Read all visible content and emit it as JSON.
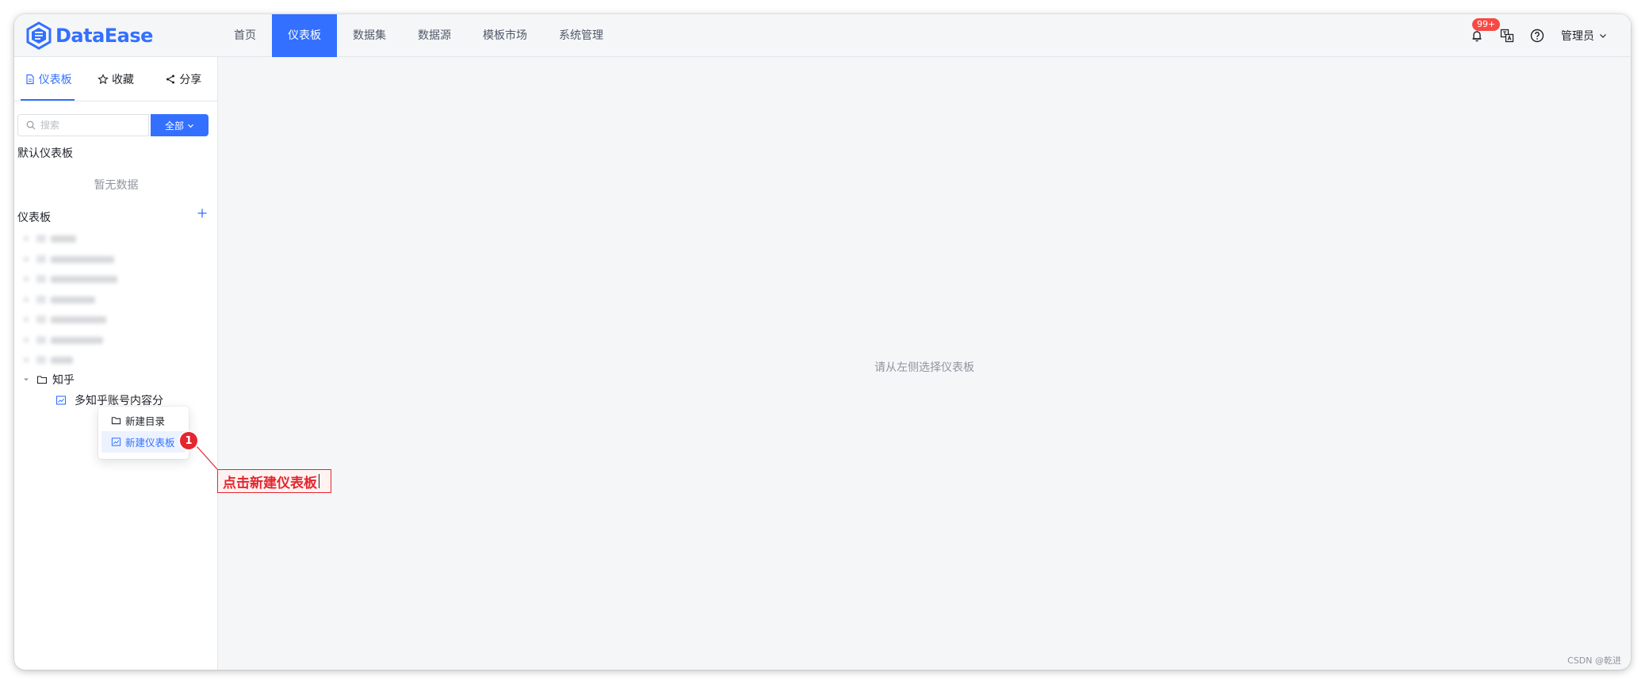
{
  "app": {
    "logo_text": "DataEase",
    "brand_color": "#3370ff"
  },
  "nav": {
    "items": [
      {
        "label": "首页"
      },
      {
        "label": "仪表板"
      },
      {
        "label": "数据集"
      },
      {
        "label": "数据源"
      },
      {
        "label": "模板市场"
      },
      {
        "label": "系统管理"
      }
    ],
    "active_index": 1
  },
  "header": {
    "badge": "99+",
    "user": "管理员"
  },
  "sidebar": {
    "tabs": [
      {
        "label": "仪表板",
        "icon": "document-icon"
      },
      {
        "label": "收藏",
        "icon": "star-icon"
      },
      {
        "label": "分享",
        "icon": "share-icon"
      }
    ],
    "search_placeholder": "搜索",
    "filter_label": "全部",
    "default_section_title": "默认仪表板",
    "empty_text": "暂无数据",
    "section_title": "仪表板",
    "folder_name": "知乎",
    "dashboard_name": "多知乎账号内容分"
  },
  "context_menu": {
    "items": [
      {
        "label": "新建目录",
        "icon": "folder-icon"
      },
      {
        "label": "新建仪表板",
        "icon": "dashboard-icon"
      }
    ]
  },
  "main": {
    "empty_text": "请从左侧选择仪表板"
  },
  "annotation": {
    "number": "1",
    "text": "点击新建仪表板"
  },
  "watermark": "CSDN @乾进"
}
